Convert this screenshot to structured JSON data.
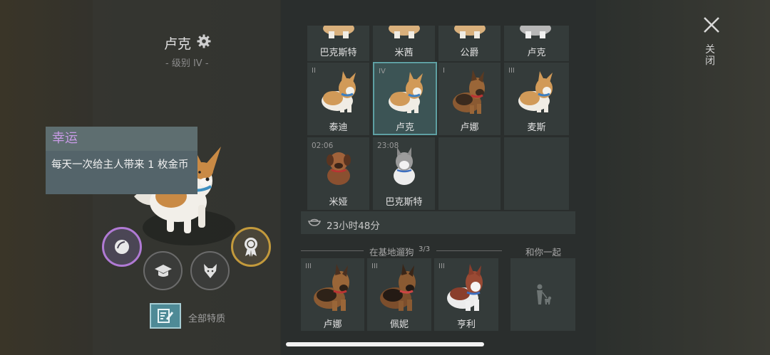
{
  "dog": {
    "name": "卢克",
    "level": "- 级别 IV -",
    "trait_title": "幸运",
    "trait_desc": "每天一次给主人带来 1 枚金币",
    "all_traits_label": "全部特质"
  },
  "colors": {
    "luck": "#b07ad4",
    "award": "#c39a3c",
    "selected": "#5e9fa2",
    "trait_title": "#c89be6"
  },
  "kennel": {
    "top_row": [
      {
        "name": "巴克斯特"
      },
      {
        "name": "米茜"
      },
      {
        "name": "公爵"
      },
      {
        "name": "卢克"
      }
    ],
    "row2": [
      {
        "level": "II",
        "name": "泰迪",
        "breed": "corgi"
      },
      {
        "level": "IV",
        "name": "卢克",
        "breed": "corgi",
        "selected": true
      },
      {
        "level": "I",
        "name": "卢娜",
        "breed": "shepherd"
      },
      {
        "level": "III",
        "name": "麦斯",
        "breed": "corgi"
      }
    ],
    "row3": [
      {
        "timer": "02:06",
        "name": "米娅",
        "breed": "puppy-brown"
      },
      {
        "timer": "23:08",
        "name": "巴克斯特",
        "breed": "puppy-husky"
      }
    ],
    "feed_time": "23小时48分"
  },
  "walking": {
    "label": "在基地遛狗",
    "count": "3/3",
    "dogs": [
      {
        "level": "III",
        "name": "卢娜",
        "breed": "shepherd"
      },
      {
        "level": "III",
        "name": "佩妮",
        "breed": "shepherd"
      },
      {
        "level": "III",
        "name": "亨利",
        "breed": "husky-red"
      }
    ],
    "with_you_label": "和你一起"
  },
  "close_label": "关闭"
}
